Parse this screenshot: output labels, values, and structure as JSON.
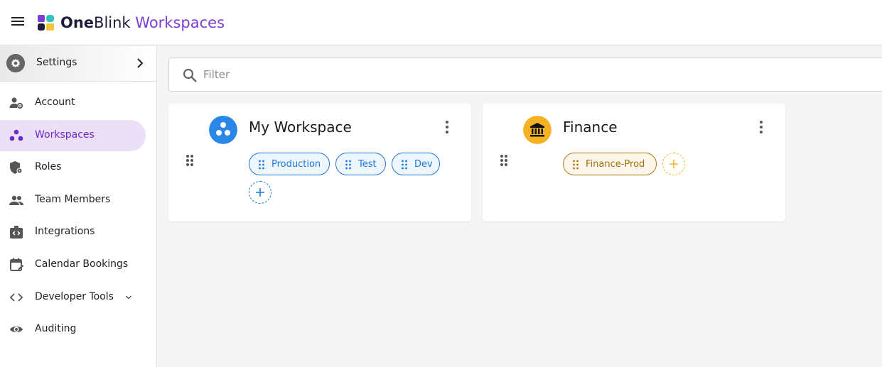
{
  "header": {
    "brand_bold": "One",
    "brand_regular": "Blink",
    "brand_product": "Workspaces",
    "menu_icon": "hamburger-menu-icon",
    "brand_color": "#7b3fd6"
  },
  "sidebar": {
    "settings_label": "Settings",
    "items": [
      {
        "label": "Account",
        "icon": "account-settings-icon"
      },
      {
        "label": "Workspaces",
        "icon": "workspaces-icon",
        "active": true
      },
      {
        "label": "Roles",
        "icon": "roles-shield-icon"
      },
      {
        "label": "Team Members",
        "icon": "team-members-icon"
      },
      {
        "label": "Integrations",
        "icon": "integrations-icon"
      },
      {
        "label": "Calendar Bookings",
        "icon": "calendar-icon"
      },
      {
        "label": "Developer Tools",
        "icon": "code-icon"
      },
      {
        "label": "Auditing",
        "icon": "eye-icon"
      }
    ],
    "active_color": "#ecdff8"
  },
  "filter": {
    "placeholder": "Filter",
    "value": ""
  },
  "workspaces": [
    {
      "name": "My Workspace",
      "icon": "workspace-circles-icon",
      "color": "#2a87e8",
      "environments": [
        "Production",
        "Test",
        "Dev"
      ]
    },
    {
      "name": "Finance",
      "icon": "bank-icon",
      "color": "#f5b324",
      "environments": [
        "Finance-Prod"
      ]
    }
  ]
}
